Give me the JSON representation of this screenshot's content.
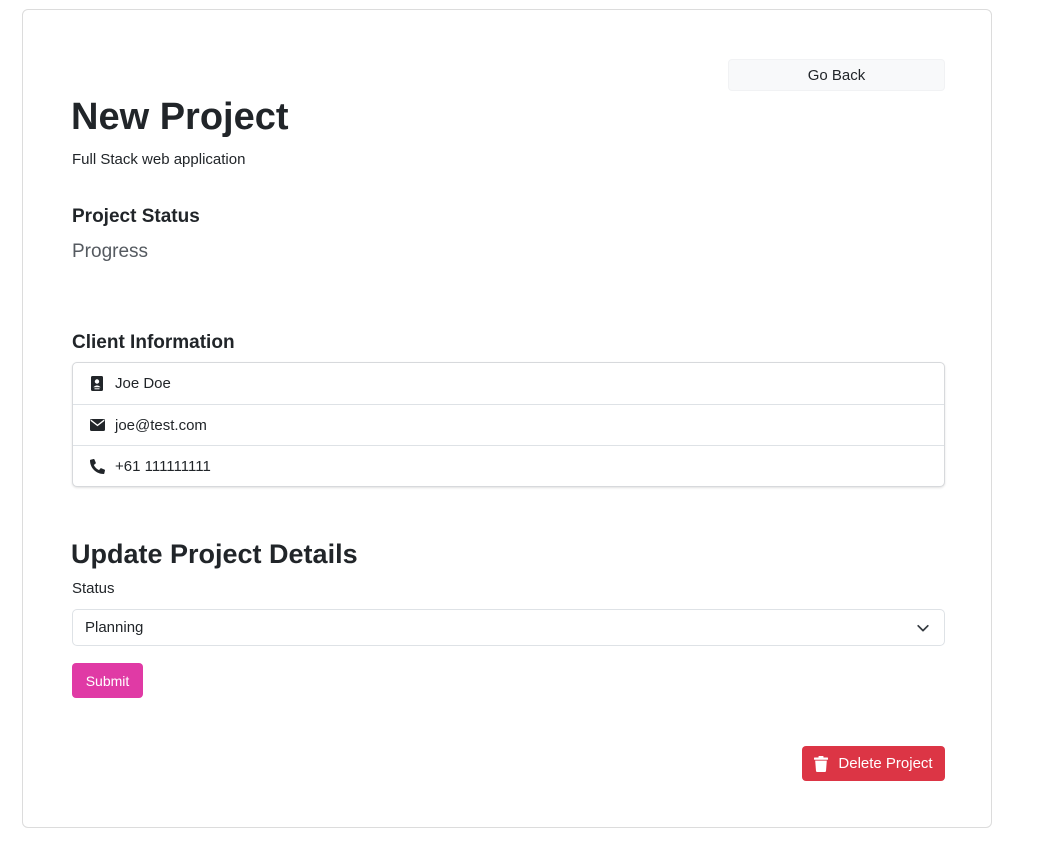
{
  "header": {
    "go_back_label": "Go Back"
  },
  "project": {
    "name": "New Project",
    "description": "Full Stack web application",
    "status_heading": "Project Status",
    "status_value": "Progress"
  },
  "client": {
    "heading": "Client Information",
    "items": [
      {
        "icon": "id-card-icon",
        "value": "Joe Doe"
      },
      {
        "icon": "envelope-icon",
        "value": "joe@test.com"
      },
      {
        "icon": "phone-icon",
        "value": "+61 111111111"
      }
    ]
  },
  "update_form": {
    "heading": "Update Project Details",
    "status_label": "Status",
    "status_selected": "Planning",
    "submit_label": "Submit"
  },
  "actions": {
    "delete_label": "Delete Project"
  },
  "colors": {
    "submit": "#e03aa5",
    "delete": "#dc3545",
    "go_back_bg": "#f8f9fa"
  }
}
